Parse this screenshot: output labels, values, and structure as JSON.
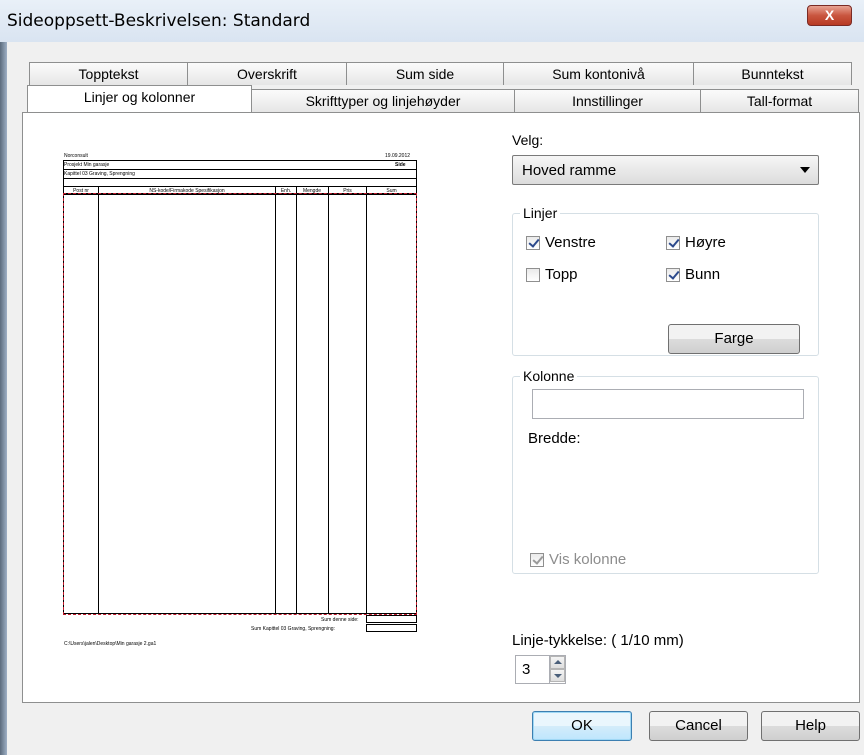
{
  "window": {
    "title": "Sideoppsett-Beskrivelsen: Standard",
    "close_label": "X"
  },
  "tabs_back": [
    "Topptekst",
    "Overskrift",
    "Sum side",
    "Sum kontonivå",
    "Bunntekst"
  ],
  "tabs_front": [
    "Linjer og kolonner",
    "Skrifttyper og linjehøyder",
    "Innstillinger",
    "Tall-format"
  ],
  "active_tab": "Linjer og kolonner",
  "preview": {
    "company": "Norconsult",
    "date": "19.09.2012",
    "project": "Prosjekt Min garasje",
    "page_label": "Side",
    "chapter": "Kapittel 03 Graving, Sprengning",
    "columns": [
      "Post nr",
      "NS-kode/Firmakode Spesifikasjon",
      "Enh.",
      "Mengde",
      "Pris",
      "Sum"
    ],
    "sum_page": "Sum denne side:",
    "sum_chapter": "Sum Kapittel 03 Graving, Sprengning:",
    "file_path": "C:\\Users\\jalen\\Desktop\\Min garasje 2.ga1"
  },
  "velg": {
    "label": "Velg:",
    "selected": "Hoved ramme"
  },
  "linjer": {
    "title": "Linjer",
    "venstre": "Venstre",
    "hoyre": "Høyre",
    "topp": "Topp",
    "bunn": "Bunn",
    "farge": "Farge"
  },
  "kolonne": {
    "title": "Kolonne",
    "value": "",
    "bredde": "Bredde:",
    "vis_kolonne": "Vis kolonne"
  },
  "tykkelse": {
    "label": "Linje-tykkelse: ( 1/10 mm)",
    "value": "3"
  },
  "buttons": {
    "ok": "OK",
    "cancel": "Cancel",
    "help": "Help"
  }
}
